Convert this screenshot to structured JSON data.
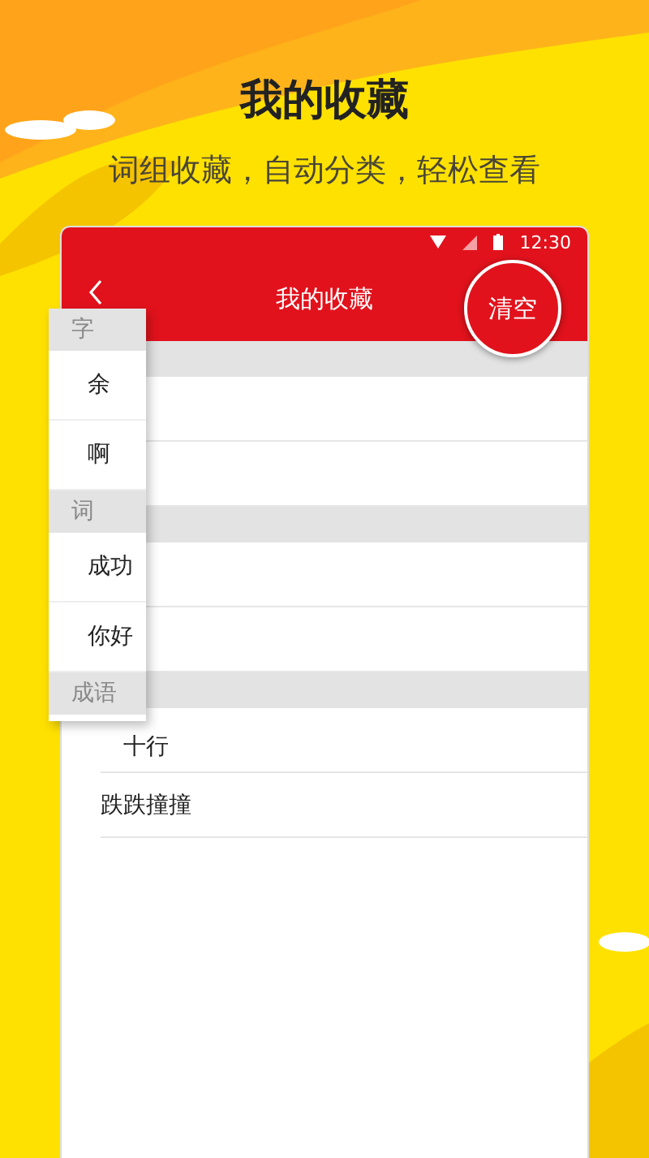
{
  "headline": "我的收藏",
  "subtitle": "词组收藏，自动分类，轻松查看",
  "status_bar": {
    "time": "12:30"
  },
  "toolbar": {
    "title": "我的收藏",
    "action": "清空"
  },
  "list": [
    {
      "kind": "header"
    },
    {
      "kind": "row"
    },
    {
      "kind": "row"
    },
    {
      "kind": "header"
    },
    {
      "kind": "row"
    },
    {
      "kind": "row"
    },
    {
      "kind": "header"
    },
    {
      "kind": "row",
      "text": "十行"
    },
    {
      "kind": "row",
      "text": "跌跌撞撞"
    }
  ],
  "index_popup": [
    {
      "kind": "header",
      "text": "字"
    },
    {
      "kind": "row",
      "text": "余"
    },
    {
      "kind": "row",
      "text": "啊"
    },
    {
      "kind": "header",
      "text": "词"
    },
    {
      "kind": "row",
      "text": "成功"
    },
    {
      "kind": "row",
      "text": "你好"
    },
    {
      "kind": "header",
      "text": "成语"
    }
  ]
}
